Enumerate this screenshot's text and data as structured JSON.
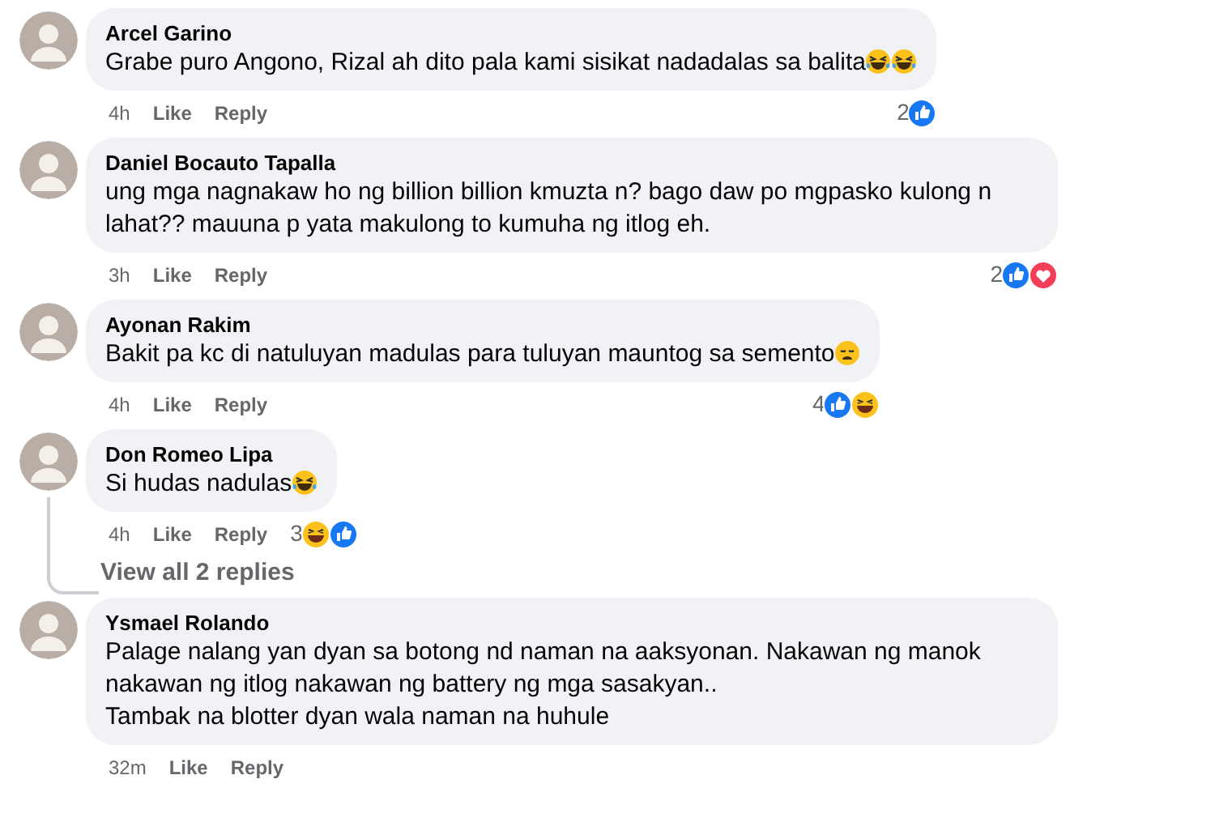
{
  "comments": [
    {
      "author": "Arcel Garino",
      "lines": [
        "Grabe puro Angono, Rizal ah dito pala kami sisikat nadadalas sa balita"
      ],
      "emojis": [
        {
          "kind": "laughing"
        },
        {
          "kind": "laughing"
        }
      ],
      "time": "4h",
      "like": "Like",
      "reply": "Reply",
      "reaction_count": "2",
      "reactions": [
        {
          "kind": "like"
        }
      ]
    },
    {
      "author": "Daniel Bocauto Tapalla",
      "lines": [
        "ung mga nagnakaw ho ng billion billion kmuzta n? bago daw po mgpasko kulong n lahat?? mauuna p yata makulong to kumuha ng itlog eh."
      ],
      "time": "3h",
      "like": "Like",
      "reply": "Reply",
      "reaction_count": "2",
      "reactions": [
        {
          "kind": "like"
        },
        {
          "kind": "love"
        }
      ]
    },
    {
      "author": "Ayonan Rakim",
      "lines": [
        "Bakit pa kc di natuluyan madulas para tuluyan mauntog sa semento"
      ],
      "emojis": [
        {
          "kind": "weary"
        }
      ],
      "time": "4h",
      "like": "Like",
      "reply": "Reply",
      "reaction_count": "4",
      "reactions": [
        {
          "kind": "like"
        },
        {
          "kind": "haha"
        }
      ]
    },
    {
      "author": "Don Romeo Lipa",
      "lines": [
        "Si hudas nadulas"
      ],
      "emojis": [
        {
          "kind": "laughing"
        }
      ],
      "time": "4h",
      "like": "Like",
      "reply": "Reply",
      "reaction_count": "3",
      "reactions": [
        {
          "kind": "haha"
        },
        {
          "kind": "like"
        }
      ],
      "view_replies": "View all 2 replies"
    },
    {
      "author": "Ysmael Rolando",
      "lines": [
        "Palage nalang yan dyan sa botong nd naman na aaksyonan. Nakawan ng manok nakawan ng itlog nakawan ng battery ng mga sasakyan..",
        "Tambak na blotter dyan wala naman na huhule"
      ],
      "time": "32m",
      "like": "Like",
      "reply": "Reply"
    }
  ]
}
